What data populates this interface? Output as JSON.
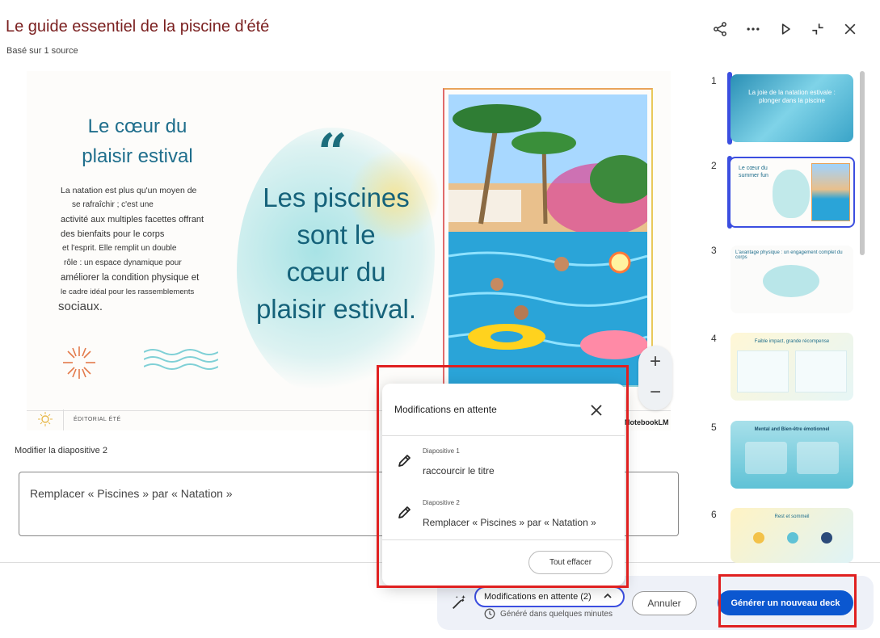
{
  "header": {
    "title": "Le guide essentiel de la piscine d'été",
    "subtitle": "Basé sur 1 source",
    "icons": [
      "share-icon",
      "more-icon",
      "play-icon",
      "collapse-icon",
      "close-icon"
    ]
  },
  "slide": {
    "heading_line1": "Le cœur du",
    "heading_line2": "plaisir estival",
    "body_lines": [
      "La natation est plus qu'un moyen de",
      "se rafraîchir ; c'est une",
      "activité aux multiples facettes offrant",
      "des bienfaits pour le corps",
      "et l'esprit. Elle remplit un double",
      "rôle : un espace dynamique pour",
      "améliorer la condition physique et",
      "le cadre idéal pour les rassemblements",
      "sociaux."
    ],
    "quote_mark": "“",
    "quote_lines": [
      "Les piscines",
      "sont le",
      "cœur du",
      "plaisir estival."
    ],
    "footer_text": "ÉDITORIAL ÉTÉ",
    "watermark": "NotebookLM"
  },
  "zoom": {
    "in": "+",
    "out": "−"
  },
  "edit": {
    "label": "Modifier la diapositive 2",
    "value": "Remplacer « Piscines » par « Natation »"
  },
  "pending_popup": {
    "title": "Modifications en attente",
    "changes": [
      {
        "slide_label": "Diapositive 1",
        "text": "raccourcir le titre"
      },
      {
        "slide_label": "Diapositive 2",
        "text": "Remplacer « Piscines » par « Natation »"
      }
    ],
    "clear_all": "Tout effacer"
  },
  "bottom": {
    "pending_label": "Modifications en attente (2)",
    "generated_text": "Généré dans quelques minutes",
    "cancel": "Annuler",
    "generate": "Générer un nouveau deck"
  },
  "thumbnails": [
    {
      "number": "1",
      "title": "La joie de la natation estivale : plonger dans la piscine",
      "selected": false
    },
    {
      "number": "2",
      "title": "Le cœur du summer fun",
      "selected": true
    },
    {
      "number": "3",
      "title": "L'avantage physique : un engagement complet du corps",
      "selected": false
    },
    {
      "number": "4",
      "title": "Faible impact, grande récompense",
      "selected": false
    },
    {
      "number": "5",
      "title": "Mental and Bien-être émotionnel",
      "selected": false
    },
    {
      "number": "6",
      "title": "Rest et sommeil",
      "selected": false
    }
  ],
  "colors": {
    "accent": "#3b4ee0",
    "primary_button": "#0b57d0",
    "annotation_red": "#e02020",
    "title_color": "#7a1f1f",
    "slide_teal": "#1f6e8c"
  }
}
